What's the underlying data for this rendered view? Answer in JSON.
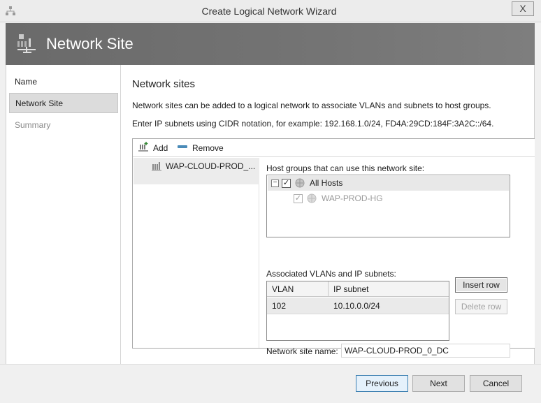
{
  "window": {
    "title": "Create Logical Network Wizard",
    "close_glyph": "X"
  },
  "banner": {
    "title": "Network Site"
  },
  "nav": {
    "items": [
      {
        "label": "Name",
        "state": "normal"
      },
      {
        "label": "Network Site",
        "state": "selected"
      },
      {
        "label": "Summary",
        "state": "disabled"
      }
    ]
  },
  "content": {
    "section_title": "Network sites",
    "description": "Network sites can be added to a logical network to associate VLANs and subnets to host groups.",
    "cidr_hint": "Enter IP subnets using CIDR notation, for example: 192.168.1.0/24, FD4A:29CD:184F:3A2C::/64.",
    "toolbar": {
      "add_label": "Add",
      "remove_label": "Remove"
    },
    "sites": [
      {
        "label": "WAP-CLOUD-PROD_..."
      }
    ],
    "host_groups_label": "Host groups that can use this network site:",
    "host_groups": [
      {
        "label": "All Hosts",
        "checked": true,
        "enabled": true,
        "expanded": true,
        "expander_glyph": "−",
        "check_glyph": "✓"
      },
      {
        "label": "WAP-PROD-HG",
        "checked": true,
        "enabled": false,
        "check_glyph": "✓"
      }
    ],
    "subnets_label": "Associated VLANs and IP subnets:",
    "subnet_table": {
      "columns": [
        "VLAN",
        "IP subnet"
      ],
      "rows": [
        {
          "vlan": "102",
          "subnet": "10.10.0.0/24"
        }
      ]
    },
    "insert_row_label": "Insert row",
    "delete_row_label": "Delete row",
    "site_name_label": "Network site name:",
    "site_name_value": "WAP-CLOUD-PROD_0_DC"
  },
  "footer": {
    "previous_label": "Previous",
    "next_label": "Next",
    "cancel_label": "Cancel"
  },
  "colors": {
    "banner": "#6f6f6f",
    "selection": "#dcdcdc",
    "default_button": "#3c7fb1"
  }
}
